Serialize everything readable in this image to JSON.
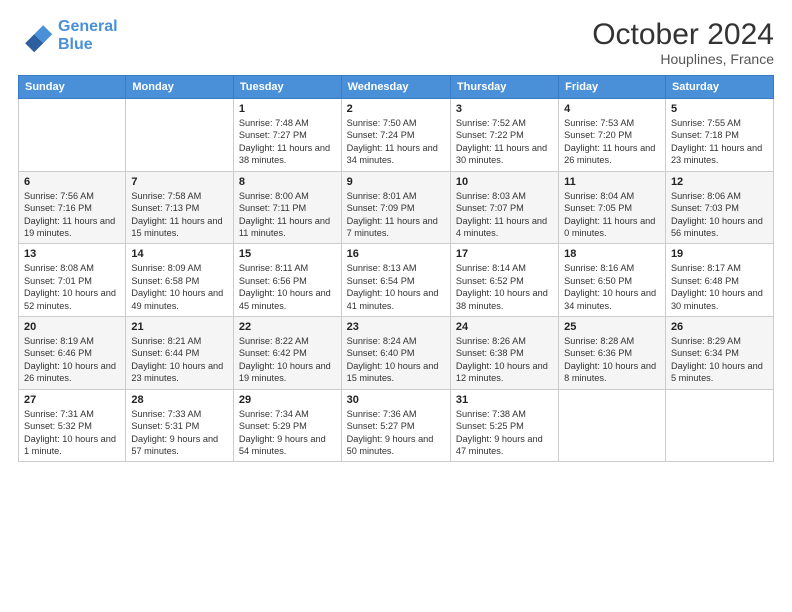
{
  "header": {
    "logo_line1": "General",
    "logo_line2": "Blue",
    "month": "October 2024",
    "location": "Houplines, France"
  },
  "weekdays": [
    "Sunday",
    "Monday",
    "Tuesday",
    "Wednesday",
    "Thursday",
    "Friday",
    "Saturday"
  ],
  "weeks": [
    [
      {
        "num": "",
        "info": ""
      },
      {
        "num": "",
        "info": ""
      },
      {
        "num": "1",
        "info": "Sunrise: 7:48 AM\nSunset: 7:27 PM\nDaylight: 11 hours and 38 minutes."
      },
      {
        "num": "2",
        "info": "Sunrise: 7:50 AM\nSunset: 7:24 PM\nDaylight: 11 hours and 34 minutes."
      },
      {
        "num": "3",
        "info": "Sunrise: 7:52 AM\nSunset: 7:22 PM\nDaylight: 11 hours and 30 minutes."
      },
      {
        "num": "4",
        "info": "Sunrise: 7:53 AM\nSunset: 7:20 PM\nDaylight: 11 hours and 26 minutes."
      },
      {
        "num": "5",
        "info": "Sunrise: 7:55 AM\nSunset: 7:18 PM\nDaylight: 11 hours and 23 minutes."
      }
    ],
    [
      {
        "num": "6",
        "info": "Sunrise: 7:56 AM\nSunset: 7:16 PM\nDaylight: 11 hours and 19 minutes."
      },
      {
        "num": "7",
        "info": "Sunrise: 7:58 AM\nSunset: 7:13 PM\nDaylight: 11 hours and 15 minutes."
      },
      {
        "num": "8",
        "info": "Sunrise: 8:00 AM\nSunset: 7:11 PM\nDaylight: 11 hours and 11 minutes."
      },
      {
        "num": "9",
        "info": "Sunrise: 8:01 AM\nSunset: 7:09 PM\nDaylight: 11 hours and 7 minutes."
      },
      {
        "num": "10",
        "info": "Sunrise: 8:03 AM\nSunset: 7:07 PM\nDaylight: 11 hours and 4 minutes."
      },
      {
        "num": "11",
        "info": "Sunrise: 8:04 AM\nSunset: 7:05 PM\nDaylight: 11 hours and 0 minutes."
      },
      {
        "num": "12",
        "info": "Sunrise: 8:06 AM\nSunset: 7:03 PM\nDaylight: 10 hours and 56 minutes."
      }
    ],
    [
      {
        "num": "13",
        "info": "Sunrise: 8:08 AM\nSunset: 7:01 PM\nDaylight: 10 hours and 52 minutes."
      },
      {
        "num": "14",
        "info": "Sunrise: 8:09 AM\nSunset: 6:58 PM\nDaylight: 10 hours and 49 minutes."
      },
      {
        "num": "15",
        "info": "Sunrise: 8:11 AM\nSunset: 6:56 PM\nDaylight: 10 hours and 45 minutes."
      },
      {
        "num": "16",
        "info": "Sunrise: 8:13 AM\nSunset: 6:54 PM\nDaylight: 10 hours and 41 minutes."
      },
      {
        "num": "17",
        "info": "Sunrise: 8:14 AM\nSunset: 6:52 PM\nDaylight: 10 hours and 38 minutes."
      },
      {
        "num": "18",
        "info": "Sunrise: 8:16 AM\nSunset: 6:50 PM\nDaylight: 10 hours and 34 minutes."
      },
      {
        "num": "19",
        "info": "Sunrise: 8:17 AM\nSunset: 6:48 PM\nDaylight: 10 hours and 30 minutes."
      }
    ],
    [
      {
        "num": "20",
        "info": "Sunrise: 8:19 AM\nSunset: 6:46 PM\nDaylight: 10 hours and 26 minutes."
      },
      {
        "num": "21",
        "info": "Sunrise: 8:21 AM\nSunset: 6:44 PM\nDaylight: 10 hours and 23 minutes."
      },
      {
        "num": "22",
        "info": "Sunrise: 8:22 AM\nSunset: 6:42 PM\nDaylight: 10 hours and 19 minutes."
      },
      {
        "num": "23",
        "info": "Sunrise: 8:24 AM\nSunset: 6:40 PM\nDaylight: 10 hours and 15 minutes."
      },
      {
        "num": "24",
        "info": "Sunrise: 8:26 AM\nSunset: 6:38 PM\nDaylight: 10 hours and 12 minutes."
      },
      {
        "num": "25",
        "info": "Sunrise: 8:28 AM\nSunset: 6:36 PM\nDaylight: 10 hours and 8 minutes."
      },
      {
        "num": "26",
        "info": "Sunrise: 8:29 AM\nSunset: 6:34 PM\nDaylight: 10 hours and 5 minutes."
      }
    ],
    [
      {
        "num": "27",
        "info": "Sunrise: 7:31 AM\nSunset: 5:32 PM\nDaylight: 10 hours and 1 minute."
      },
      {
        "num": "28",
        "info": "Sunrise: 7:33 AM\nSunset: 5:31 PM\nDaylight: 9 hours and 57 minutes."
      },
      {
        "num": "29",
        "info": "Sunrise: 7:34 AM\nSunset: 5:29 PM\nDaylight: 9 hours and 54 minutes."
      },
      {
        "num": "30",
        "info": "Sunrise: 7:36 AM\nSunset: 5:27 PM\nDaylight: 9 hours and 50 minutes."
      },
      {
        "num": "31",
        "info": "Sunrise: 7:38 AM\nSunset: 5:25 PM\nDaylight: 9 hours and 47 minutes."
      },
      {
        "num": "",
        "info": ""
      },
      {
        "num": "",
        "info": ""
      }
    ]
  ]
}
